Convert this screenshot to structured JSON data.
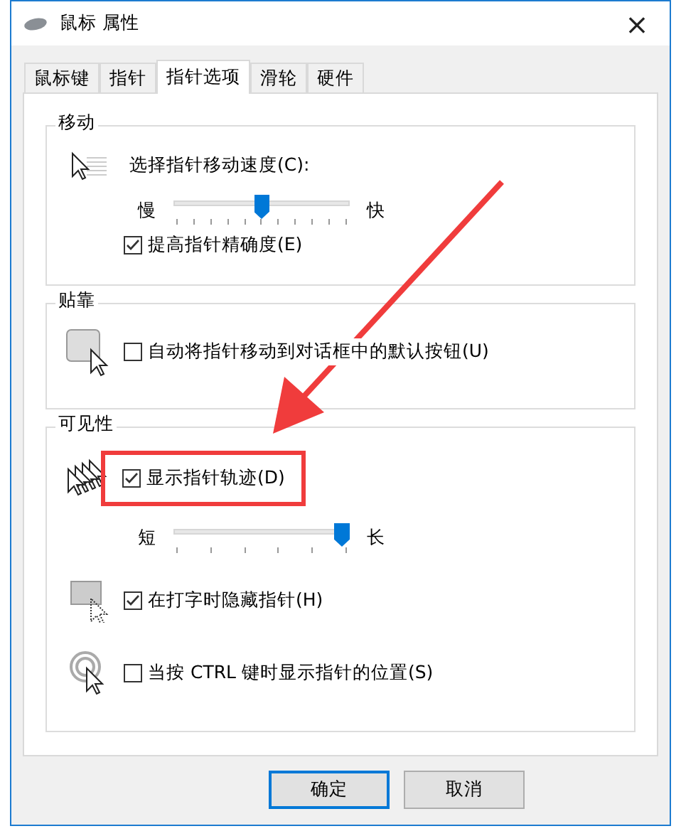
{
  "window": {
    "title": "鼠标 属性",
    "close": "×"
  },
  "tabs": [
    {
      "label": "鼠标键",
      "selected": false
    },
    {
      "label": "指针",
      "selected": false
    },
    {
      "label": "指针选项",
      "selected": true
    },
    {
      "label": "滑轮",
      "selected": false
    },
    {
      "label": "硬件",
      "selected": false
    }
  ],
  "groups": [
    {
      "title": "移动",
      "rows": [
        {
          "kind": "label",
          "text": "选择指针移动速度(C):"
        },
        {
          "kind": "slider",
          "min_label": "慢",
          "max_label": "快",
          "level": 0.5
        },
        {
          "kind": "checkbox",
          "text": "提高指针精确度(E)",
          "checked": true
        }
      ]
    },
    {
      "title": "贴靠",
      "rows": [
        {
          "kind": "checkbox",
          "text": "自动将指针移动到对话框中的默认按钮(U)",
          "checked": false
        }
      ]
    },
    {
      "title": "可见性",
      "rows": [
        {
          "kind": "checkbox",
          "text": "显示指针轨迹(D)",
          "checked": true,
          "highlighted": true
        },
        {
          "kind": "slider",
          "min_label": "短",
          "max_label": "长",
          "level": 1
        },
        {
          "kind": "checkbox",
          "text": "在打字时隐藏指针(H)",
          "checked": true
        },
        {
          "kind": "checkbox",
          "text": "当按 CTRL 键时显示指针的位置(S)",
          "checked": false
        }
      ]
    }
  ],
  "buttons": [
    {
      "label": "确定",
      "default": true
    },
    {
      "label": "取消",
      "default": false
    }
  ]
}
